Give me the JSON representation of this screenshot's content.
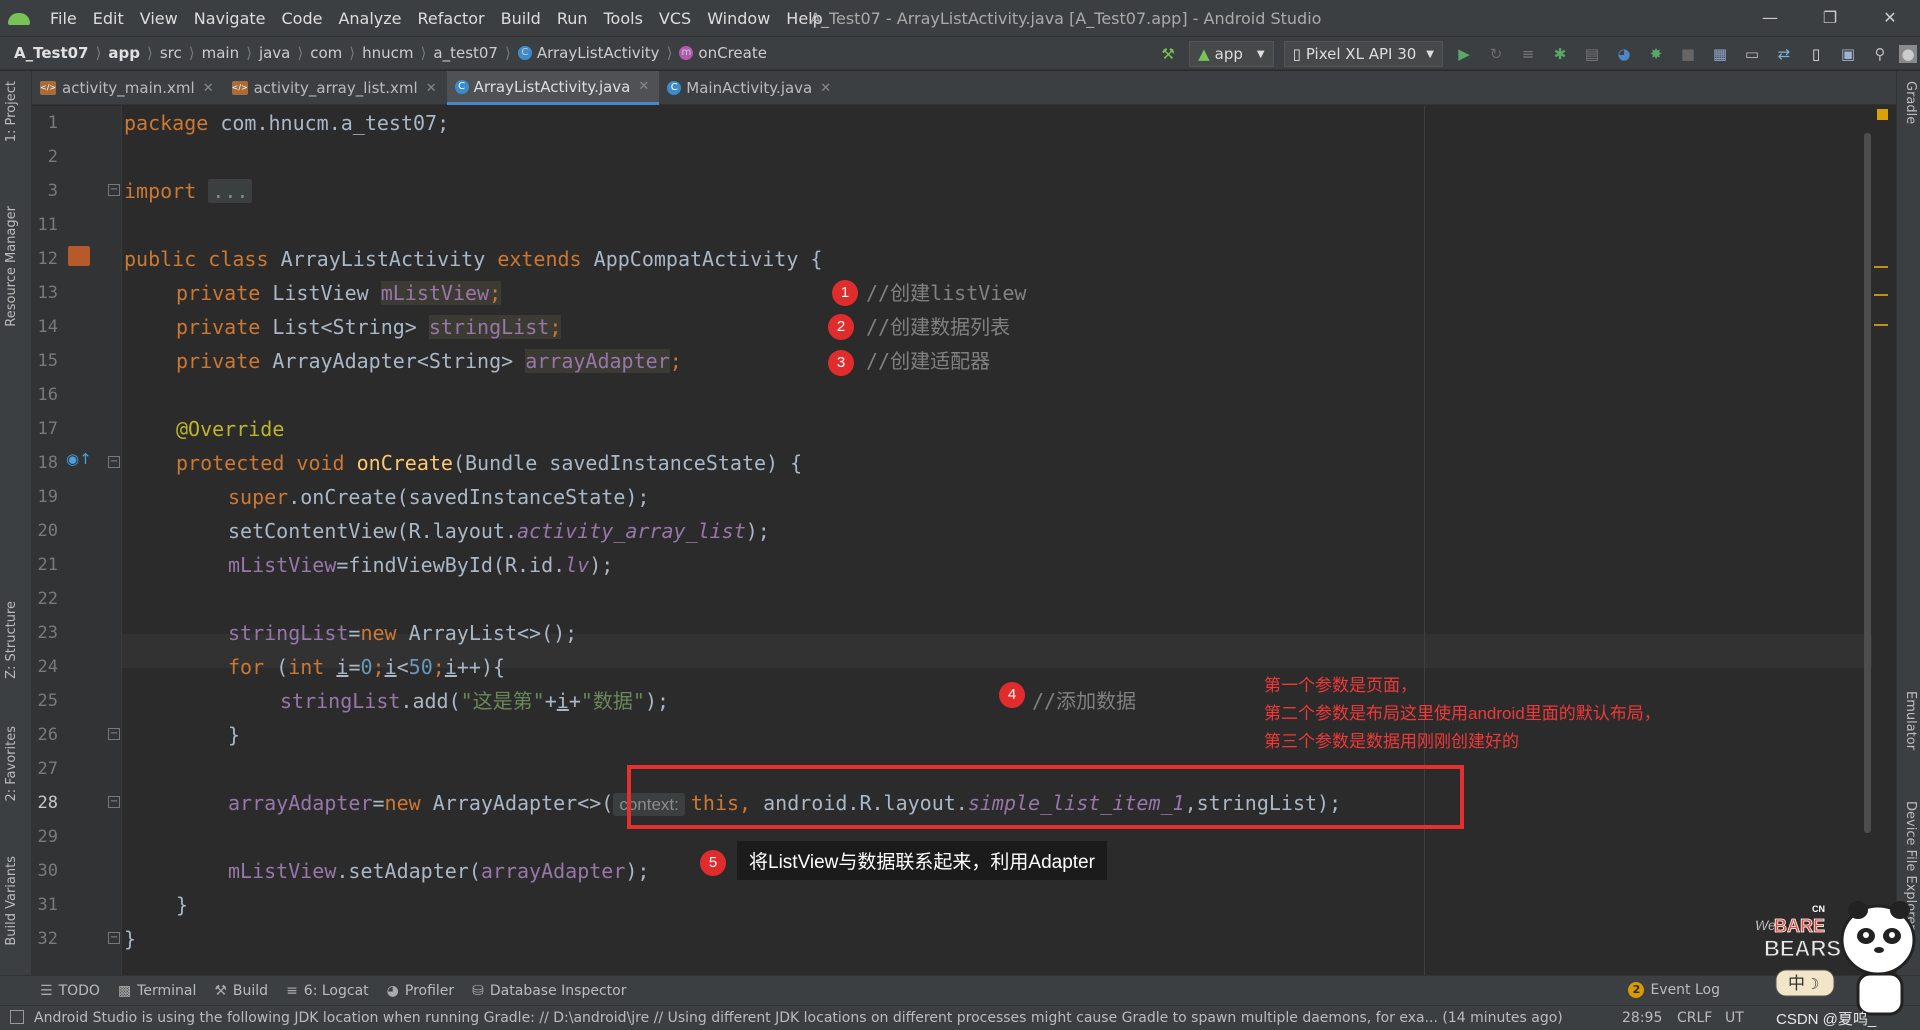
{
  "menubar": {
    "items": [
      "File",
      "Edit",
      "View",
      "Navigate",
      "Code",
      "Analyze",
      "Refactor",
      "Build",
      "Run",
      "Tools",
      "VCS",
      "Window",
      "Help"
    ],
    "window_title": "A_Test07 - ArrayListActivity.java [A_Test07.app] - Android Studio"
  },
  "breadcrumb": [
    "A_Test07",
    "app",
    "src",
    "main",
    "java",
    "com",
    "hnucm",
    "a_test07",
    "ArrayListActivity",
    "onCreate"
  ],
  "toolbar": {
    "run_config": "app",
    "device": "Pixel XL API 30"
  },
  "tabs": [
    {
      "label": "activity_main.xml",
      "type": "xml"
    },
    {
      "label": "activity_array_list.xml",
      "type": "xml"
    },
    {
      "label": "ArrayListActivity.java",
      "type": "java",
      "active": true
    },
    {
      "label": "MainActivity.java",
      "type": "java"
    }
  ],
  "left_tools": [
    "1: Project",
    "Resource Manager",
    "Z: Structure",
    "2: Favorites",
    "Build Variants"
  ],
  "right_tools": [
    "Gradle",
    "Emulator",
    "Device File Explorer"
  ],
  "line_numbers": [
    "1",
    "2",
    "3",
    "11",
    "12",
    "13",
    "14",
    "15",
    "16",
    "17",
    "18",
    "19",
    "20",
    "21",
    "22",
    "23",
    "24",
    "25",
    "26",
    "27",
    "28",
    "29",
    "30",
    "31",
    "32"
  ],
  "code": {
    "package_kw": "package",
    "package_name": "com.hnucm.a_test07;",
    "import_kw": "import",
    "import_fold": "...",
    "public_kw": "public",
    "class_kw": "class",
    "class_name": "ArrayListActivity",
    "extends_kw": "extends",
    "super_class": "AppCompatActivity {",
    "private_kw": "private",
    "l13_type": "ListView",
    "l13_field": "mListView",
    "l14_type": "List<String>",
    "l14_field": "stringList",
    "l15_type": "ArrayAdapter<String>",
    "l15_field": "arrayAdapter",
    "semi": ";",
    "override": "@Override",
    "protected_kw": "protected",
    "void_kw": "void",
    "oncreate": "onCreate",
    "oncreate_args": "(Bundle savedInstanceState) {",
    "super_kw": "super",
    "super_call": ".onCreate(savedInstanceState);",
    "setcontent_a": "setContentView(R.layout.",
    "setcontent_b": "activity_array_list",
    "setcontent_c": ");",
    "find_a": "mListView",
    "find_b": "=findViewById(R.id.",
    "find_c": "lv",
    "find_d": ");",
    "sl_field": "stringList",
    "eq": "=",
    "new_kw": "new",
    "sl_new": " ArrayList<>();",
    "for_kw": "for",
    "for_open": " (",
    "int_kw": "int",
    "for_i": "i",
    "for_eq0": "=",
    "for_0": "0",
    "for_semi": ";",
    "for_lt": "<",
    "for_50": "50",
    "for_inc": "++){",
    "add_a": ".add(",
    "add_s1": "\"这是第\"",
    "add_plus1": "+",
    "add_plus2": "+",
    "add_s2": "\"数据\"",
    "add_end": ");",
    "close_brace": "}",
    "aa_field": "arrayAdapter",
    "aa_new": " ArrayAdapter<>(",
    "aa_hint": "context:",
    "aa_this": "this",
    "aa_comma": ", ",
    "aa_res": "android.R.layout.",
    "aa_item": "simple_list_item_1",
    "aa_sl": ",stringList",
    "aa_end": ");",
    "setadapter_a": ".setAdapter(",
    "setadapter_b": ");"
  },
  "comments": {
    "c1": "//创建listView",
    "c2": "//创建数据列表",
    "c3": "//创建适配器",
    "c4": "//添加数据"
  },
  "badges": [
    "1",
    "2",
    "3",
    "4",
    "5"
  ],
  "annotation": [
    "第一个参数是页面，",
    "第二个参数是布局这里使用android里面的默认布局，",
    "第三个参数是数据用刚刚创建好的"
  ],
  "tooltip": "将ListView与数据联系起来，利用Adapter",
  "bottom_tools": [
    "TODO",
    "Terminal",
    "Build",
    "6: Logcat",
    "Profiler",
    "Database Inspector"
  ],
  "event_log": {
    "count": "2",
    "label": "Event Log"
  },
  "status": {
    "message": "Android Studio is using the following JDK location when running Gradle: // D:\\android\\jre // Using different JDK locations on different processes might cause Gradle to spawn multiple daemons, for exa... (14 minutes ago)",
    "position": "28:95",
    "line_sep": "CRLF",
    "encoding": "UT"
  },
  "watermark": {
    "title_a": "We",
    "title_b": "BARE",
    "title_c": "BEARS",
    "cn": "CN",
    "chars": "中",
    "footer": "CSDN @夏呜_"
  },
  "colors": {
    "accent": "#4a88c7",
    "keyword": "#cc7832",
    "field": "#9876aa",
    "annotation_red": "#e53030"
  }
}
